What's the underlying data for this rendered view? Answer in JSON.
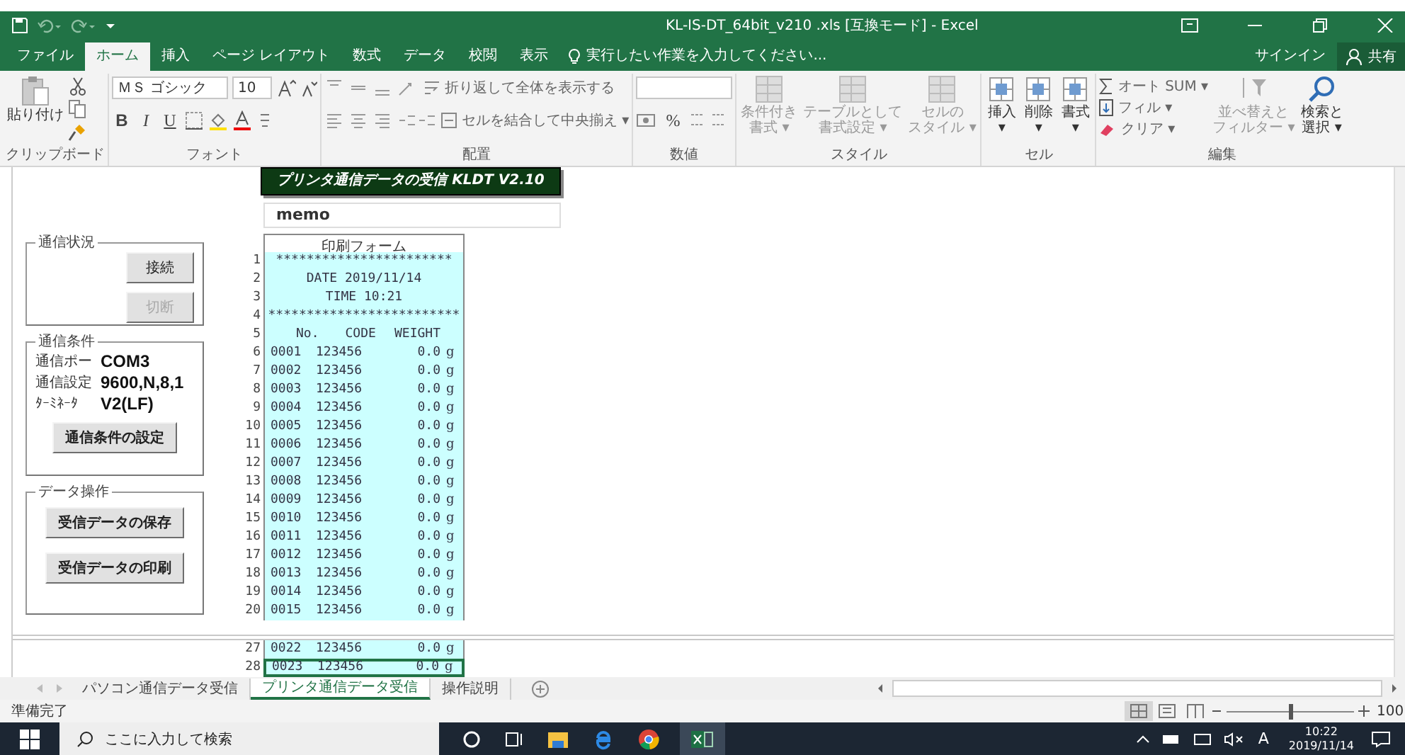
{
  "title_bar": {
    "title": "KL-IS-DT_64bit_v210 .xls  [互換モード] - Excel"
  },
  "menu_tabs": [
    {
      "label": "ファイル",
      "selected": false
    },
    {
      "label": "ホーム",
      "selected": true
    },
    {
      "label": "挿入",
      "selected": false
    },
    {
      "label": "ページ レイアウト",
      "selected": false
    },
    {
      "label": "数式",
      "selected": false
    },
    {
      "label": "データ",
      "selected": false
    },
    {
      "label": "校閲",
      "selected": false
    },
    {
      "label": "表示",
      "selected": false
    }
  ],
  "tell_me": "実行したい作業を入力してください...",
  "sign_in": "サインイン",
  "share": "共有",
  "ribbon": {
    "clipboard": {
      "paste": "貼り付け",
      "label": "クリップボード"
    },
    "font": {
      "name": "ＭＳ ゴシック",
      "size": "10",
      "bold": "B",
      "italic": "I",
      "underline": "U",
      "label": "フォント"
    },
    "alignment": {
      "wrap": "折り返して全体を表示する",
      "merge": "セルを結合して中央揃え ▾",
      "label": "配置"
    },
    "number": {
      "percent": "%",
      "label": "数値"
    },
    "styles": {
      "items": [
        {
          "lines": [
            "条件付き",
            "書式 ▾"
          ]
        },
        {
          "lines": [
            "テーブルとして",
            "書式設定 ▾"
          ]
        },
        {
          "lines": [
            "セルの",
            "スタイル ▾"
          ]
        }
      ],
      "label": "スタイル"
    },
    "cells": {
      "items": [
        {
          "lines": [
            "挿入",
            "▾"
          ]
        },
        {
          "lines": [
            "削除",
            "▾"
          ]
        },
        {
          "lines": [
            "書式",
            "▾"
          ]
        }
      ],
      "label": "セル"
    },
    "editing": {
      "autosum": "オート SUM ▾",
      "fill": "フィル ▾",
      "clear": "クリア ▾",
      "sort": [
        "並べ替えと",
        "フィルター ▾"
      ],
      "find": [
        "検索と",
        "選択 ▾"
      ],
      "label": "編集"
    }
  },
  "panels": [
    {
      "title": "通信状況",
      "kind": "status",
      "buttons": [
        {
          "label": "接続",
          "disabled": false
        },
        {
          "label": "切断",
          "disabled": true
        }
      ]
    },
    {
      "title": "通信条件",
      "kind": "settings",
      "settings": [
        {
          "label": "通信ポー",
          "value": "COM3"
        },
        {
          "label": "通信設定",
          "value": "9600,N,8,1"
        },
        {
          "label": "ﾀｰﾐﾈｰﾀ",
          "value": "V2(LF)"
        }
      ],
      "buttons": [
        {
          "label": "通信条件の設定",
          "disabled": false
        }
      ]
    },
    {
      "title": "データ操作",
      "kind": "actions",
      "buttons": [
        {
          "label": "受信データの保存",
          "disabled": false
        },
        {
          "label": "受信データの印刷",
          "disabled": false
        }
      ]
    }
  ],
  "sheet": {
    "banner": "プリンタ通信データの受信 KLDT V2.10",
    "memo": "memo",
    "form": {
      "title": "印刷フォーム",
      "rows": [
        {
          "num": "1",
          "kind": "text",
          "text": "***********************"
        },
        {
          "num": "2",
          "kind": "text",
          "text": "DATE  2019/11/14"
        },
        {
          "num": "3",
          "kind": "text",
          "text": "TIME  10:21"
        },
        {
          "num": "4",
          "kind": "text",
          "text": "*************************"
        },
        {
          "num": "5",
          "kind": "heading",
          "no": "No.",
          "code": "CODE",
          "weight": "WEIGHT"
        },
        {
          "num": "6",
          "kind": "data",
          "no": "0001",
          "code": "123456",
          "weight": "0.0",
          "unit": "g"
        },
        {
          "num": "7",
          "kind": "data",
          "no": "0002",
          "code": "123456",
          "weight": "0.0",
          "unit": "g"
        },
        {
          "num": "8",
          "kind": "data",
          "no": "0003",
          "code": "123456",
          "weight": "0.0",
          "unit": "g"
        },
        {
          "num": "9",
          "kind": "data",
          "no": "0004",
          "code": "123456",
          "weight": "0.0",
          "unit": "g"
        },
        {
          "num": "10",
          "kind": "data",
          "no": "0005",
          "code": "123456",
          "weight": "0.0",
          "unit": "g"
        },
        {
          "num": "11",
          "kind": "data",
          "no": "0006",
          "code": "123456",
          "weight": "0.0",
          "unit": "g"
        },
        {
          "num": "12",
          "kind": "data",
          "no": "0007",
          "code": "123456",
          "weight": "0.0",
          "unit": "g"
        },
        {
          "num": "13",
          "kind": "data",
          "no": "0008",
          "code": "123456",
          "weight": "0.0",
          "unit": "g"
        },
        {
          "num": "14",
          "kind": "data",
          "no": "0009",
          "code": "123456",
          "weight": "0.0",
          "unit": "g"
        },
        {
          "num": "15",
          "kind": "data",
          "no": "0010",
          "code": "123456",
          "weight": "0.0",
          "unit": "g"
        },
        {
          "num": "16",
          "kind": "data",
          "no": "0011",
          "code": "123456",
          "weight": "0.0",
          "unit": "g"
        },
        {
          "num": "17",
          "kind": "data",
          "no": "0012",
          "code": "123456",
          "weight": "0.0",
          "unit": "g"
        },
        {
          "num": "18",
          "kind": "data",
          "no": "0013",
          "code": "123456",
          "weight": "0.0",
          "unit": "g"
        },
        {
          "num": "19",
          "kind": "data",
          "no": "0014",
          "code": "123456",
          "weight": "0.0",
          "unit": "g"
        },
        {
          "num": "20",
          "kind": "data",
          "no": "0015",
          "code": "123456",
          "weight": "0.0",
          "unit": "g"
        }
      ],
      "split_rows": [
        {
          "num": "27",
          "no": "0022",
          "code": "123456",
          "weight": "0.0",
          "unit": "g",
          "selected": false
        },
        {
          "num": "28",
          "no": "0023",
          "code": "123456",
          "weight": "0.0",
          "unit": "g",
          "selected": true
        }
      ]
    }
  },
  "sheet_tabs": [
    {
      "label": "パソコン通信データ受信",
      "selected": false
    },
    {
      "label": "プリンタ通信データ受信",
      "selected": true
    },
    {
      "label": "操作説明",
      "selected": false
    }
  ],
  "status_bar": {
    "text": "準備完了",
    "zoom": "100",
    "level": 0.5
  },
  "taskbar": {
    "search": "ここに入力して検索",
    "ime": "A",
    "time": "10:22",
    "date": "2019/11/14"
  }
}
